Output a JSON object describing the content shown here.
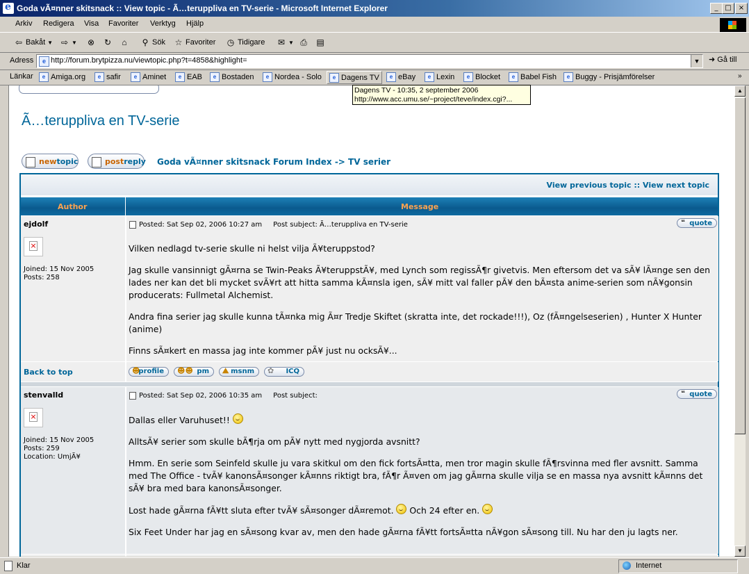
{
  "window": {
    "title": "Goda vÃ¤nner skitsnack :: View topic - Ã…teruppliva en TV-serie - Microsoft Internet Explorer",
    "controls": [
      "_",
      "□",
      "×"
    ]
  },
  "menubar": [
    "Arkiv",
    "Redigera",
    "Visa",
    "Favoriter",
    "Verktyg",
    "Hjälp"
  ],
  "toolbar": {
    "back": "Bakåt",
    "search": "Sök",
    "favorites": "Favoriter",
    "history": "Tidigare"
  },
  "address": {
    "label": "Adress",
    "url": "http://forum.brytpizza.nu/viewtopic.php?t=4858&highlight=",
    "go": "Gå till"
  },
  "links": {
    "label": "Länkar",
    "items": [
      "Amiga.org",
      "safir",
      "Aminet",
      "EAB",
      "Bostaden",
      "Nordea - Solo",
      "Dagens TV",
      "eBay",
      "Lexin",
      "Blocket",
      "Babel Fish",
      "Buggy - Prisjämförelser"
    ]
  },
  "tooltip": {
    "line1": "Dagens TV - 10:35, 2 september 2006",
    "line2": "http://www.acc.umu.se/~project/teve/index.cgi?..."
  },
  "page": {
    "topic_title": "Ã…teruppliva en TV-serie",
    "new_topic": {
      "a": "new",
      "b": "topic"
    },
    "post_reply": {
      "a": "post",
      "b": "reply"
    },
    "nav": {
      "forum_index": "Goda vÃ¤nner skitsnack Forum Index",
      "sep": "->",
      "forum": "TV serier"
    },
    "prev_topic": "View previous topic",
    "next_topic": "View next topic",
    "nav_sep": "::",
    "col_author": "Author",
    "col_message": "Message",
    "back_to_top": "Back to top",
    "quote": "quote",
    "profile_buttons": [
      "profile",
      "pm",
      "msnm",
      "ICQ"
    ]
  },
  "posts": [
    {
      "author": "ejdolf",
      "joined": "Joined: 15 Nov 2005",
      "posts": "Posts: 258",
      "location": "",
      "posted": "Posted: Sat Sep 02, 2006 10:27 am",
      "subject": "Post subject: Ã…teruppliva en TV-serie",
      "paragraphs": [
        "Vilken nedlagd tv-serie skulle ni helst vilja Ã¥teruppstod?",
        "Jag skulle vansinnigt gÃ¤rna se Twin-Peaks Ã¥teruppstÃ¥, med Lynch som regissÃ¶r givetvis. Men eftersom det va sÃ¥ lÃ¤nge sen den lades ner kan det bli mycket svÃ¥rt att hitta samma kÃ¤nsla igen, sÃ¥ mitt val faller pÃ¥ den bÃ¤sta anime-serien som nÃ¥gonsin producerats: Fullmetal Alchemist.",
        "Andra fina serier jag skulle kunna tÃ¤nka mig Ã¤r Tredje Skiftet (skratta inte, det rockade!!!), Oz (fÃ¤ngelseserien) , Hunter X Hunter (anime)",
        "Finns sÃ¤kert en massa jag inte kommer pÃ¥ just nu ocksÃ¥..."
      ]
    },
    {
      "author": "stenvalld",
      "joined": "Joined: 15 Nov 2005",
      "posts": "Posts: 259",
      "location": "Location: UmjÃ¥",
      "posted": "Posted: Sat Sep 02, 2006 10:35 am",
      "subject": "Post subject:",
      "p1": "Dallas eller Varuhuset!!",
      "p2": "AlltsÃ¥ serier som skulle bÃ¶rja om pÃ¥ nytt med nygjorda avsnitt?",
      "p3": "Hmm. En serie som Seinfeld skulle ju vara skitkul om den fick fortsÃ¤tta, men tror magin skulle fÃ¶rsvinna med fler avsnitt. Samma med The Office - tvÃ¥ kanonsÃ¤songer kÃ¤nns riktigt bra, fÃ¶r Ã¤ven om jag gÃ¤rna skulle vilja se en massa nya avsnitt kÃ¤nns det sÃ¥ bra med bara kanonsÃ¤songer.",
      "p4a": "Lost hade gÃ¤rna fÃ¥tt sluta efter tvÃ¥ sÃ¤songer dÃ¤remot.",
      "p4b": "Och 24 efter en.",
      "p5": "Six Feet Under har jag en sÃ¤song kvar av, men den hade gÃ¤rna fÃ¥tt fortsÃ¤tta nÃ¥gon sÃ¤song till. Nu har den ju lagts ner."
    }
  ],
  "statusbar": {
    "text": "Klar",
    "zone": "Internet"
  }
}
